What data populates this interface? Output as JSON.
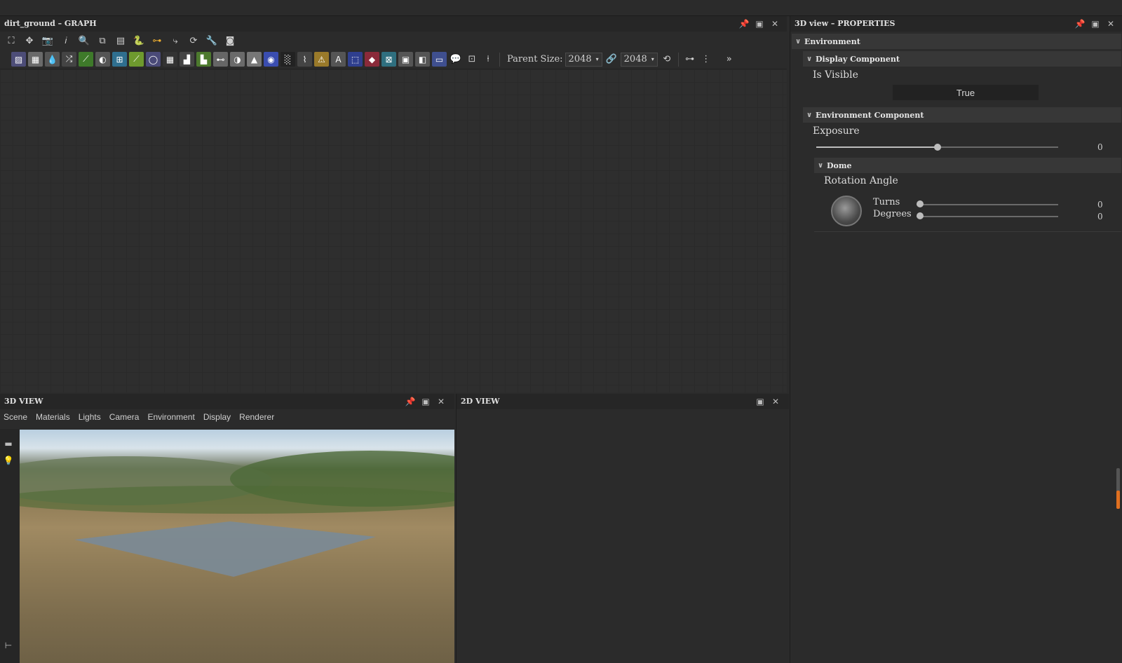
{
  "graph": {
    "title": "dirt_ground – GRAPH",
    "parent_size_label": "Parent Size:",
    "width_value": "2048",
    "height_value": "2048"
  },
  "view3d": {
    "title": "3D VIEW",
    "menu": [
      "Scene",
      "Materials",
      "Lights",
      "Camera",
      "Environment",
      "Display",
      "Renderer"
    ]
  },
  "view2d": {
    "title": "2D VIEW"
  },
  "props": {
    "title": "3D view – PROPERTIES",
    "environment": "Environment",
    "display_component": "Display Component",
    "is_visible_label": "Is Visible",
    "is_visible_value": "True",
    "environment_component": "Environment Component",
    "exposure_label": "Exposure",
    "exposure_value": "0",
    "exposure_fraction": 0.5,
    "dome": "Dome",
    "rotation_label": "Rotation Angle",
    "turns_label": "Turns",
    "turns_value": "0",
    "degrees_label": "Degrees",
    "degrees_value": "0"
  }
}
